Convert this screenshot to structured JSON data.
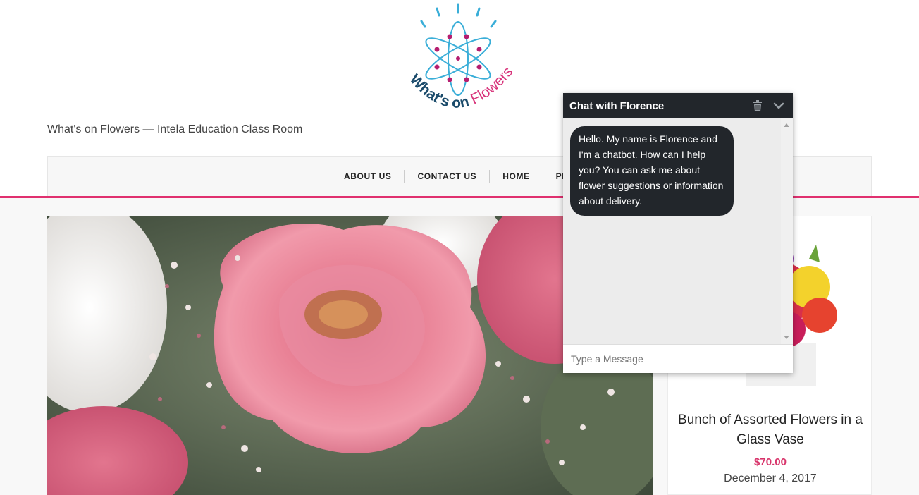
{
  "site": {
    "logo_text_dark": "What's on",
    "logo_text_pink": "Flowers",
    "tagline": "What's on Flowers — Intela Education Class Room"
  },
  "nav": {
    "items": [
      {
        "label": "ABOUT US"
      },
      {
        "label": "CONTACT US"
      },
      {
        "label": "HOME"
      },
      {
        "label": "PRODUCTS"
      }
    ]
  },
  "product": {
    "title": "Bunch of Assorted Flowers in a Glass Vase",
    "price": "$70.00",
    "date": "December 4, 2017"
  },
  "chat": {
    "title": "Chat with Florence",
    "delete_icon": "trash-icon",
    "collapse_icon": "chevron-down-icon",
    "message": "Hello. My name is Florence and I'm a chatbot. How can I help you? You can ask me about flower suggestions or information about delivery.",
    "input_placeholder": "Type a Message"
  },
  "colors": {
    "accent": "#e0306f",
    "price": "#d8336a",
    "chat_dark": "#22262b",
    "logo_blue": "#3aaed8",
    "logo_navy": "#1b4b6b"
  }
}
